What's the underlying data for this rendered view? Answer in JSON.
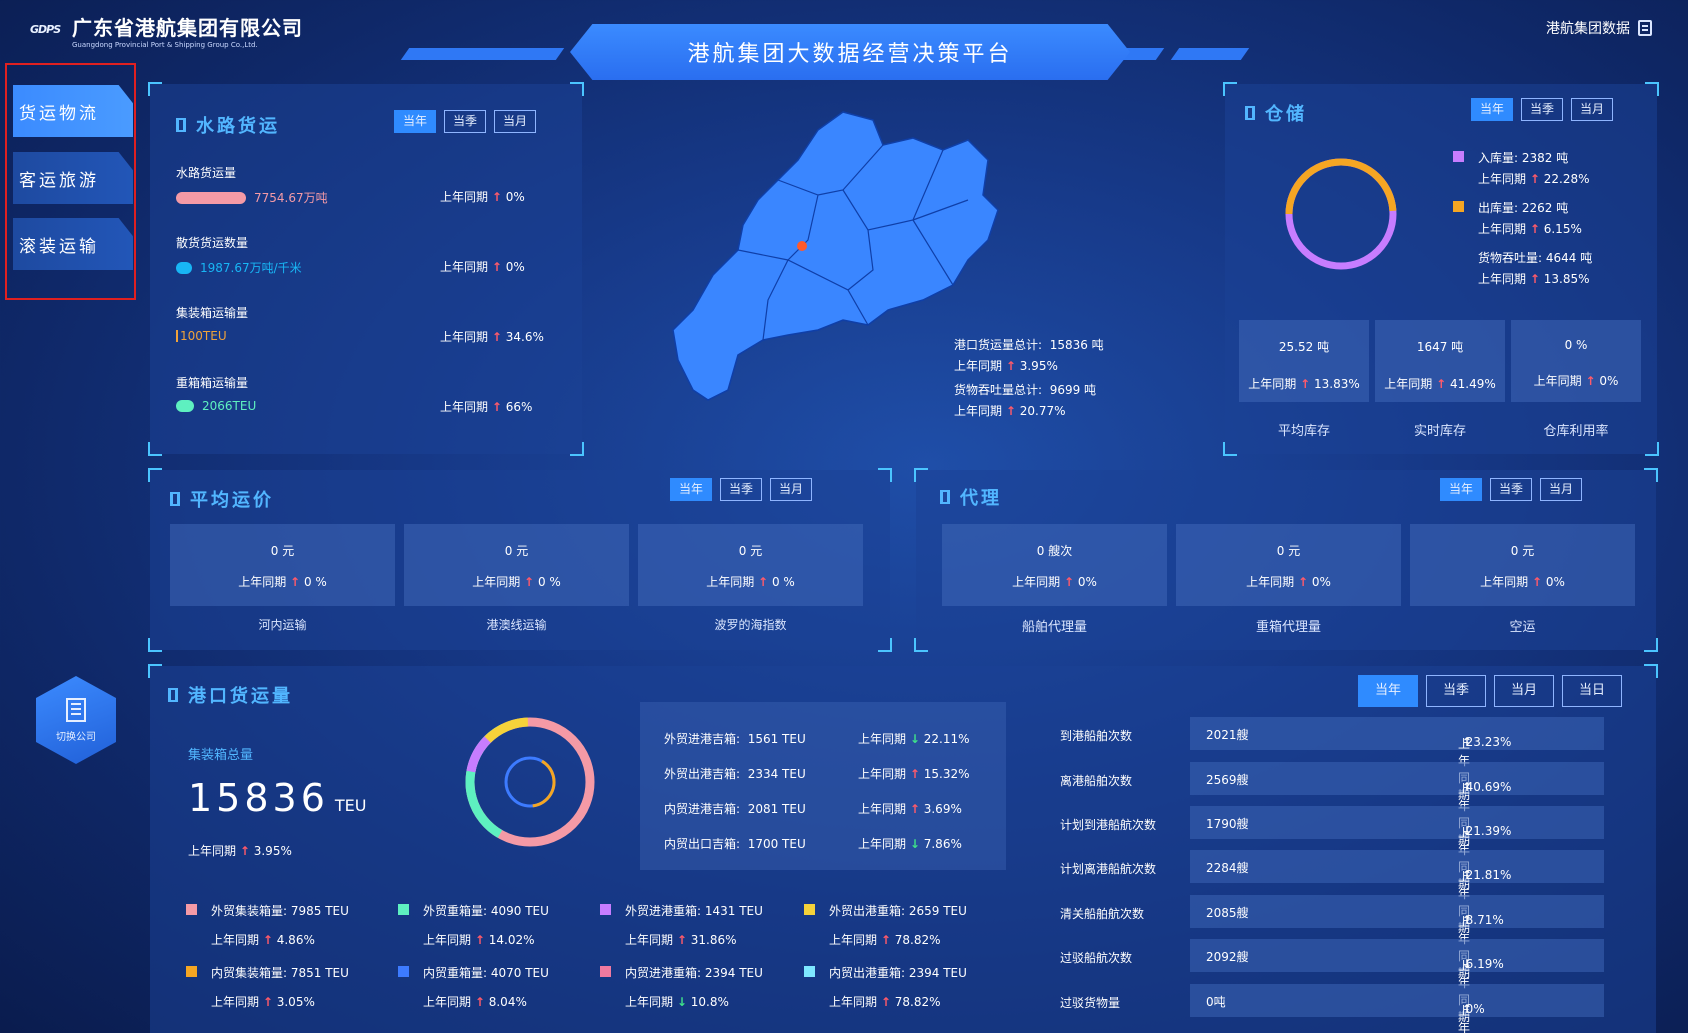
{
  "header": {
    "company_cn": "广东省港航集团有限公司",
    "company_en": "Guangdong Provincial Port & Shipping Group Co.,Ltd.",
    "logo_mark": "GDPS",
    "platform_title": "港航集团大数据经营决策平台",
    "top_right_link": "港航集团数据"
  },
  "nav": {
    "items": [
      {
        "label": "货运物流",
        "active": true
      },
      {
        "label": "客运旅游",
        "active": false
      },
      {
        "label": "滚装运输",
        "active": false
      }
    ],
    "switch_company": "切换公司"
  },
  "tabs": {
    "year": "当年",
    "season": "当季",
    "month": "当月",
    "day": "当日"
  },
  "water": {
    "title": "水路货运",
    "rows": [
      {
        "label": "水路货运量",
        "value": "7754.67万吨",
        "compare_label": "上年同期",
        "compare": "0%",
        "dir": "up",
        "color": "#f08a9a"
      },
      {
        "label": "散货货运数量",
        "value": "1987.67万吨/千米",
        "compare_label": "上年同期",
        "compare": "0%",
        "dir": "up",
        "color": "#18b6f5"
      },
      {
        "label": "集装箱运输量",
        "value": "100TEU",
        "compare_label": "上年同期",
        "compare": "34.6%",
        "dir": "up",
        "color": "#f0a23a"
      },
      {
        "label": "重箱箱运输量",
        "value": "2066TEU",
        "compare_label": "上年同期",
        "compare": "66%",
        "dir": "up",
        "color": "#5ef0c0"
      }
    ]
  },
  "map_stats": {
    "port_total_label": "港口货运量总计:",
    "port_total_value": "15836 吨",
    "port_compare_label": "上年同期",
    "port_compare": "3.95%",
    "throughput_label": "货物吞吐量总计:",
    "throughput_value": "9699 吨",
    "throughput_compare_label": "上年同期",
    "throughput_compare": "20.77%"
  },
  "storage": {
    "title": "仓储",
    "in_label": "入库量:",
    "in_value": "2382 吨",
    "in_compare_label": "上年同期",
    "in_compare": "22.28%",
    "out_label": "出库量:",
    "out_value": "2262 吨",
    "out_compare_label": "上年同期",
    "out_compare": "6.15%",
    "thr_label": "货物吞吐量:",
    "thr_value": "4644 吨",
    "thr_compare_label": "上年同期",
    "thr_compare": "13.85%",
    "in_color": "#c77dff",
    "out_color": "#f5a623",
    "boxes": [
      {
        "value": "25.52 吨",
        "compare_label": "上年同期",
        "compare": "13.83%",
        "caption": "平均库存"
      },
      {
        "value": "1647 吨",
        "compare_label": "上年同期",
        "compare": "41.49%",
        "caption": "实时库存"
      },
      {
        "value": "0 %",
        "compare_label": "上年同期",
        "compare": "0%",
        "caption": "仓库利用率"
      }
    ]
  },
  "avg_price": {
    "title": "平均运价",
    "boxes": [
      {
        "value": "0 元",
        "compare_label": "上年同期",
        "compare": "0 %",
        "caption": "河内运输"
      },
      {
        "value": "0 元",
        "compare_label": "上年同期",
        "compare": "0 %",
        "caption": "港澳线运输"
      },
      {
        "value": "0 元",
        "compare_label": "上年同期",
        "compare": "0 %",
        "caption": "波罗的海指数"
      }
    ]
  },
  "agency": {
    "title": "代理",
    "boxes": [
      {
        "value": "0 艘次",
        "compare_label": "上年同期",
        "compare": "0%",
        "caption": "船舶代理量"
      },
      {
        "value": "0 元",
        "compare_label": "上年同期",
        "compare": "0%",
        "caption": "重箱代理量"
      },
      {
        "value": "0 元",
        "compare_label": "上年同期",
        "compare": "0%",
        "caption": "空运"
      }
    ]
  },
  "port": {
    "title": "港口货运量",
    "container_total_label": "集装箱总量",
    "container_total_value": "15836",
    "container_total_unit": "TEU",
    "total_compare_label": "上年同期",
    "total_compare": "3.95%",
    "trade": [
      {
        "label": "外贸进港吉箱:",
        "value": "1561 TEU",
        "compare_label": "上年同期",
        "compare": "22.11%",
        "dir": "down"
      },
      {
        "label": "外贸出港吉箱:",
        "value": "2334 TEU",
        "compare_label": "上年同期",
        "compare": "15.32%",
        "dir": "up"
      },
      {
        "label": "内贸进港吉箱:",
        "value": "2081 TEU",
        "compare_label": "上年同期",
        "compare": "3.69%",
        "dir": "up"
      },
      {
        "label": "内贸出口吉箱:",
        "value": "1700 TEU",
        "compare_label": "上年同期",
        "compare": "7.86%",
        "dir": "down"
      }
    ],
    "legend": [
      {
        "label": "外贸集装箱量:",
        "value": "7985 TEU",
        "compare_label": "上年同期",
        "compare": "4.86%",
        "dir": "up",
        "color": "#f49aa6"
      },
      {
        "label": "外贸重箱量:",
        "value": "4090 TEU",
        "compare_label": "上年同期",
        "compare": "14.02%",
        "dir": "up",
        "color": "#5ef0c0"
      },
      {
        "label": "外贸进港重箱:",
        "value": "1431 TEU",
        "compare_label": "上年同期",
        "compare": "31.86%",
        "dir": "up",
        "color": "#c77dff"
      },
      {
        "label": "外贸出港重箱:",
        "value": "2659 TEU",
        "compare_label": "上年同期",
        "compare": "78.82%",
        "dir": "up",
        "color": "#f5d23a"
      },
      {
        "label": "内贸集装箱量:",
        "value": "7851 TEU",
        "compare_label": "上年同期",
        "compare": "3.05%",
        "dir": "up",
        "color": "#f5a623"
      },
      {
        "label": "内贸重箱量:",
        "value": "4070 TEU",
        "compare_label": "上年同期",
        "compare": "8.04%",
        "dir": "up",
        "color": "#3d7bff"
      },
      {
        "label": "内贸进港重箱:",
        "value": "2394 TEU",
        "compare_label": "上年同期",
        "compare": "10.8%",
        "dir": "down",
        "color": "#f07aa0"
      },
      {
        "label": "内贸出港重箱:",
        "value": "2394 TEU",
        "compare_label": "上年同期",
        "compare": "78.82%",
        "dir": "up",
        "color": "#7ee8ff"
      }
    ],
    "ships": [
      {
        "label": "到港船舶次数",
        "value": "2021艘",
        "compare_label": "上年同期",
        "compare": "23.23%",
        "dir": "up"
      },
      {
        "label": "离港船舶次数",
        "value": "2569艘",
        "compare_label": "上年同期",
        "compare": "40.69%",
        "dir": "up"
      },
      {
        "label": "计划到港船航次数",
        "value": "1790艘",
        "compare_label": "上年同期",
        "compare": "21.39%",
        "dir": "down"
      },
      {
        "label": "计划离港船航次数",
        "value": "2284艘",
        "compare_label": "上年同期",
        "compare": "21.81%",
        "dir": "up"
      },
      {
        "label": "清关船舶航次数",
        "value": "2085艘",
        "compare_label": "上年同期",
        "compare": "8.71%",
        "dir": "up"
      },
      {
        "label": "过驳船航次数",
        "value": "2092艘",
        "compare_label": "上年同期",
        "compare": "6.19%",
        "dir": "down"
      },
      {
        "label": "过驳货物量",
        "value": "0吨",
        "compare_label": "上年同期",
        "compare": "0%",
        "dir": "up"
      }
    ]
  }
}
